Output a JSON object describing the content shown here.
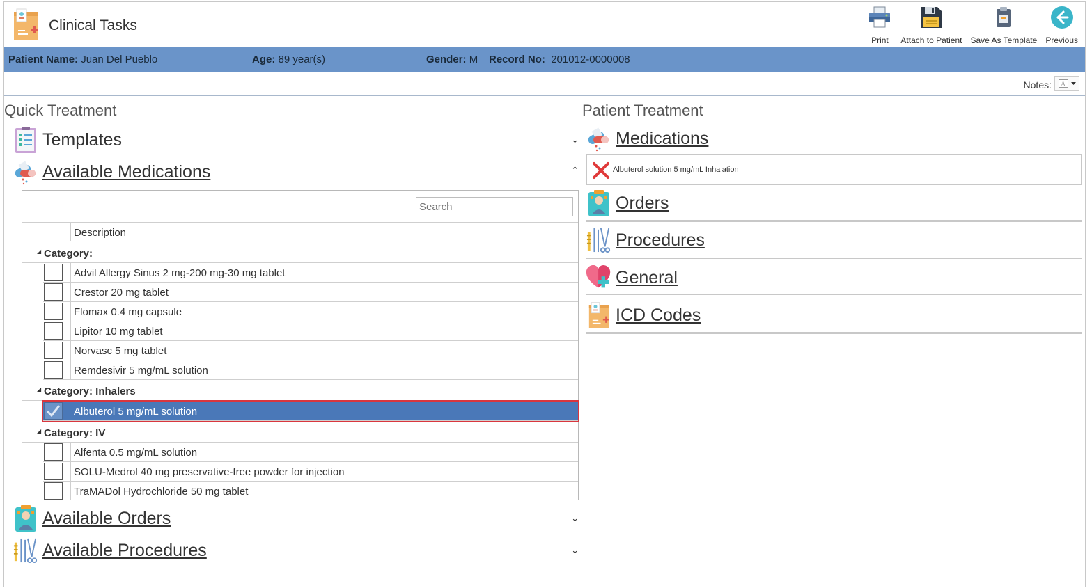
{
  "header": {
    "title": "Clinical Tasks",
    "toolbar": [
      {
        "label": "Print",
        "icon": "printer-icon"
      },
      {
        "label": "Attach to Patient",
        "icon": "save-disk-icon"
      },
      {
        "label": "Save As Template",
        "icon": "clipboard-icon"
      },
      {
        "label": "Previous",
        "icon": "back-arrow-icon"
      }
    ]
  },
  "patient": {
    "name_label": "Patient Name:",
    "name": "Juan Del Pueblo",
    "age_label": "Age:",
    "age": "89 year(s)",
    "gender_label": "Gender:",
    "gender": "M",
    "record_label": "Record No:",
    "record": "201012-0000008"
  },
  "notes": {
    "label": "Notes:"
  },
  "quick_treatment": {
    "title": "Quick Treatment",
    "templates_label": "Templates",
    "available_medications_label": "Available Medications",
    "available_orders_label": "Available Orders",
    "available_procedures_label": "Available Procedures",
    "search_placeholder": "Search",
    "column_header": "Description",
    "categories": [
      {
        "label": "Category:",
        "items": [
          {
            "text": "Advil Allergy Sinus 2 mg-200 mg-30 mg tablet",
            "checked": false
          },
          {
            "text": "Crestor 20 mg tablet",
            "checked": false
          },
          {
            "text": "Flomax 0.4 mg capsule",
            "checked": false
          },
          {
            "text": "Lipitor 10 mg tablet",
            "checked": false
          },
          {
            "text": "Norvasc 5 mg tablet",
            "checked": false
          },
          {
            "text": "Remdesivir 5 mg/mL solution",
            "checked": false
          }
        ]
      },
      {
        "label": "Category: Inhalers",
        "items": [
          {
            "text": "Albuterol 5 mg/mL solution",
            "checked": true
          }
        ]
      },
      {
        "label": "Category: IV",
        "items": [
          {
            "text": "Alfenta 0.5 mg/mL solution",
            "checked": false
          },
          {
            "text": "SOLU-Medrol 40 mg preservative-free powder for injection",
            "checked": false
          },
          {
            "text": "TraMADol Hydrochloride 50 mg tablet",
            "checked": false
          }
        ]
      }
    ]
  },
  "patient_treatment": {
    "title": "Patient Treatment",
    "medications_label": "Medications",
    "medication_entry_link": "Albuterol solution 5 mg/mL",
    "medication_entry_route": "Inhalation",
    "orders_label": "Orders",
    "procedures_label": "Procedures",
    "general_label": "General",
    "icd_label": "ICD Codes"
  },
  "colors": {
    "patient_bar": "#6a94c9",
    "selected_row": "#4a78b8",
    "highlight_border": "#d9363e"
  }
}
